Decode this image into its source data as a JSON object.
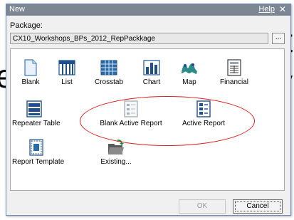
{
  "background": {
    "glyph_top": "t",
    "glyph_mid": "y",
    "glyph_left": "e"
  },
  "dialog": {
    "title": "New",
    "help_label": "Help",
    "close_glyph": "✕",
    "package_label": "Package:",
    "package_value": "CX10_Workshops_BPs_2012_RepPackkage",
    "browse_label": "...",
    "ok_label": "OK",
    "cancel_label": "Cancel"
  },
  "gallery": {
    "items": [
      {
        "label": "Blank",
        "icon": "blank-page-icon"
      },
      {
        "label": "List",
        "icon": "list-icon"
      },
      {
        "label": "Crosstab",
        "icon": "crosstab-icon"
      },
      {
        "label": "Chart",
        "icon": "bar-chart-icon"
      },
      {
        "label": "Map",
        "icon": "map-icon"
      },
      {
        "label": "Financial",
        "icon": "financial-icon"
      },
      {
        "label": "Repeater Table",
        "icon": "repeater-table-icon"
      },
      {
        "label": "Blank Active Report",
        "icon": "blank-active-report-icon"
      },
      {
        "label": "Active Report",
        "icon": "active-report-icon"
      },
      {
        "label": "Report Template",
        "icon": "report-template-icon"
      },
      {
        "label": "Existing...",
        "icon": "open-folder-icon"
      }
    ]
  },
  "colors": {
    "annotation": "#d81f1f",
    "titlebar": "#7d8794",
    "icon_blue": "#1d4f8c"
  }
}
